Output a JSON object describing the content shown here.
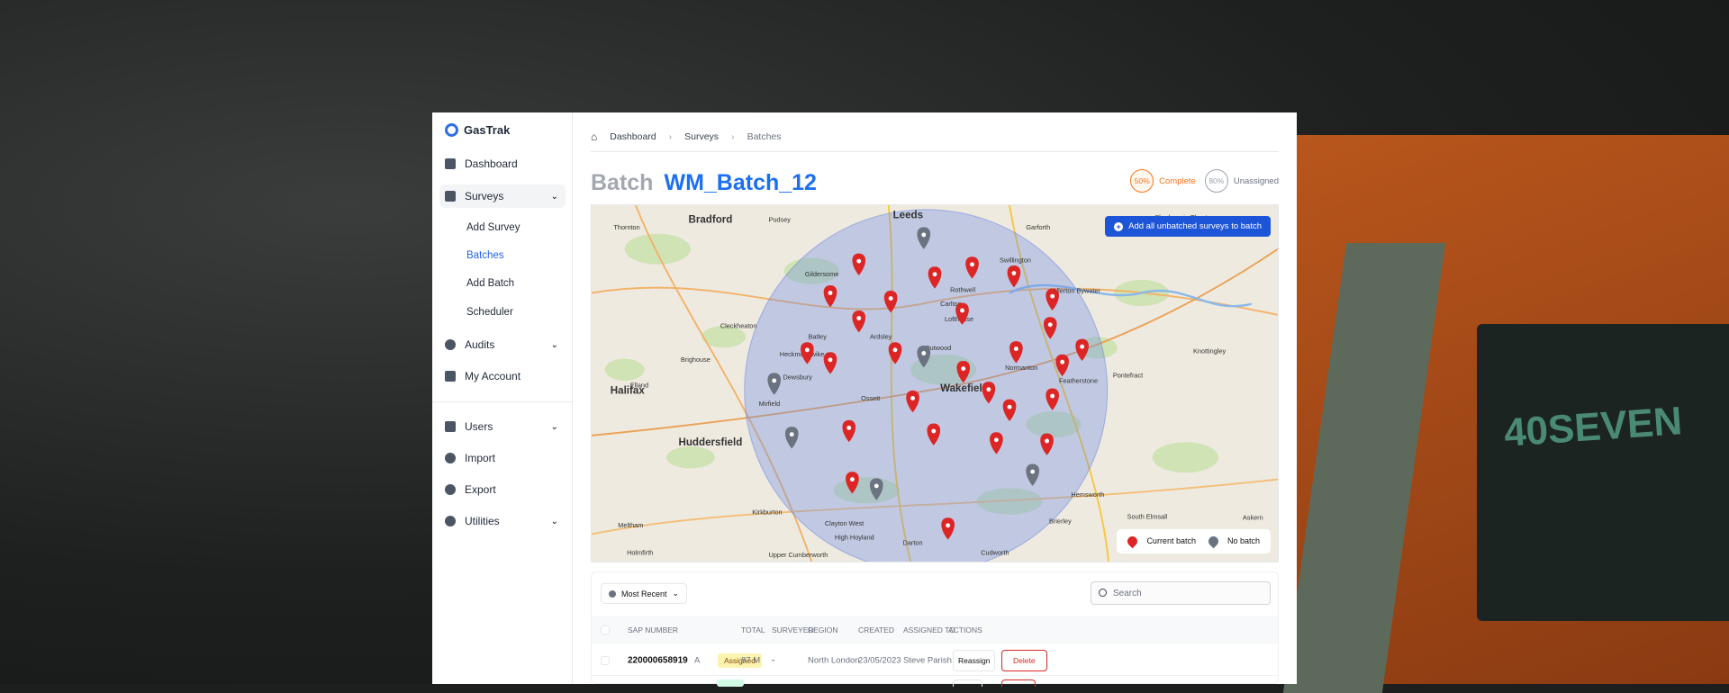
{
  "app": {
    "name": "GasTrak",
    "accent": "#1d6ff2"
  },
  "sidebar": {
    "items": [
      {
        "label": "Dashboard",
        "icon": "dashboard-icon"
      },
      {
        "label": "Surveys",
        "icon": "clipboard-icon",
        "expanded": true
      },
      {
        "label": "Audits",
        "icon": "check-circle-icon"
      },
      {
        "label": "My Account",
        "icon": "lock-icon"
      },
      {
        "label": "Users",
        "icon": "users-icon"
      },
      {
        "label": "Import",
        "icon": "cloud-upload-icon"
      },
      {
        "label": "Export",
        "icon": "cloud-download-icon"
      },
      {
        "label": "Utilities",
        "icon": "gear-icon"
      }
    ],
    "survey_sub": [
      "Add Survey",
      "Batches",
      "Add Batch",
      "Scheduler"
    ],
    "selected_sub": "Batches"
  },
  "breadcrumb": [
    "Dashboard",
    "Surveys",
    "Batches"
  ],
  "header": {
    "label": "Batch",
    "name": "WM_Batch_12"
  },
  "stats": {
    "complete": {
      "value": "50%",
      "label": "Complete",
      "color": "#f97316"
    },
    "unassigned": {
      "value": "80%",
      "label": "Unassigned",
      "color": "#9ca3af"
    }
  },
  "map": {
    "add_button": "Add all unbatched surveys to batch",
    "legend": {
      "current": "Current batch",
      "none": "No batch",
      "current_color": "#dc2626",
      "none_color": "#6b7280"
    },
    "places": [
      "Leeds",
      "Bradford",
      "Pudsey",
      "Thornton",
      "Garforth",
      "Sherburn in Elmet",
      "Swillington",
      "Gildersome",
      "Rothwell",
      "Carlton",
      "Lofthouse",
      "Allerton Bywater",
      "Halifax",
      "Cleckheaton",
      "Brighouse",
      "Heckmondwike",
      "Batley",
      "Elland",
      "Mirfield",
      "Dewsbury",
      "Ossett",
      "Wakefield",
      "Normanton",
      "Featherstone",
      "Pontefract",
      "Knottingley",
      "Huddersfield",
      "Kirkburton",
      "Meltham",
      "Holmfirth",
      "Clayton West",
      "High Hoyland",
      "Darton",
      "Cudworth",
      "Hemsworth",
      "Brierley",
      "South Elmsall",
      "Askern",
      "Upper Cumberworth",
      "Outwood",
      "Ardsley"
    ]
  },
  "table": {
    "sort": "Most Recent",
    "search_placeholder": "Search",
    "columns": [
      "SAP NUMBER",
      "TOTAL",
      "SURVEYED",
      "REGION",
      "CREATED",
      "ASSIGNED TO",
      "ACTIONS"
    ],
    "rows": [
      {
        "sap": "220000658919",
        "type": "A",
        "status": "Assigned",
        "total": "87 M",
        "surveyed": "-",
        "region": "North London",
        "created": "23/05/2023",
        "assigned": "Steve Parish",
        "reassign": "Reassign",
        "delete": "Delete"
      }
    ]
  }
}
